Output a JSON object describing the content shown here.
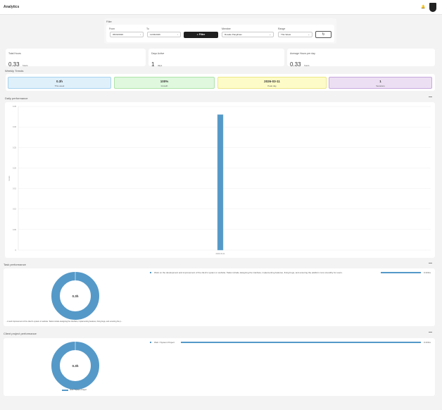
{
  "header": {
    "title": "Analytics",
    "bell_icon": "bell-icon",
    "avatar_icon": "logo-shield-icon"
  },
  "filter": {
    "title": "Filter",
    "from_label": "From",
    "from_value": "05/03/2026",
    "to_label": "To",
    "to_value": "11/03/2026",
    "filter_button": "Filter",
    "member_label": "Member",
    "member_value": "Rosalie Pangilinan",
    "range_label": "Range",
    "range_value": "This Week",
    "refresh_icon": "refresh-icon"
  },
  "stats": [
    {
      "label": "Total Hours",
      "value": "0.33",
      "unit": "hours"
    },
    {
      "label": "Days Active",
      "value": "1",
      "unit": "days"
    },
    {
      "label": "Average Hours per day",
      "value": "0.33",
      "unit": "hours"
    }
  ],
  "weekly": {
    "title": "Weekly Trends",
    "items": [
      {
        "value": "0.3h",
        "label": "This week",
        "bg": "#dff0fb",
        "border": "#a9d3ef"
      },
      {
        "value": "100%",
        "label": "Growth",
        "bg": "#dff8de",
        "border": "#aee4a9"
      },
      {
        "value": "2026-03-11",
        "label": "Peak day",
        "bg": "#fdfcc8",
        "border": "#ece78a"
      },
      {
        "value": "1",
        "label": "Sessions",
        "bg": "#ecdff3",
        "border": "#c8a9dd"
      }
    ]
  },
  "daily": {
    "title": "Daily performance",
    "menu": "—"
  },
  "chart_data": {
    "type": "bar",
    "categories": [
      "2026-03-11"
    ],
    "values": [
      0.33
    ],
    "ylabel": "Hours",
    "ylim": [
      0,
      0.35
    ],
    "yticks": [
      "0.35",
      "0.30",
      "0.25",
      "0.20",
      "0.15",
      "0.10",
      "0.05",
      "0"
    ],
    "color": "#5599c8",
    "grid": true
  },
  "task": {
    "title": "Task performance",
    "menu": "—",
    "center": "0.3h",
    "item": "Work on the development and improvement of the client's system or website. Tasks include designing the interface, implementing features, fixing bugs, and ensuring the platform runs smoothly for users.",
    "value": "0.33hrs",
    "legend": "...nt and improvement of the client's system or website. Tasks include designing the interface, implementing features, fixing bugs, and ensuring the p...",
    "fraction": 1.0
  },
  "client": {
    "title": "Client project performance",
    "menu": "—",
    "center": "0.3h",
    "item": "Web / System Project",
    "value": "0.33hrs",
    "legend": "Web / System Project",
    "fraction": 1.0
  }
}
